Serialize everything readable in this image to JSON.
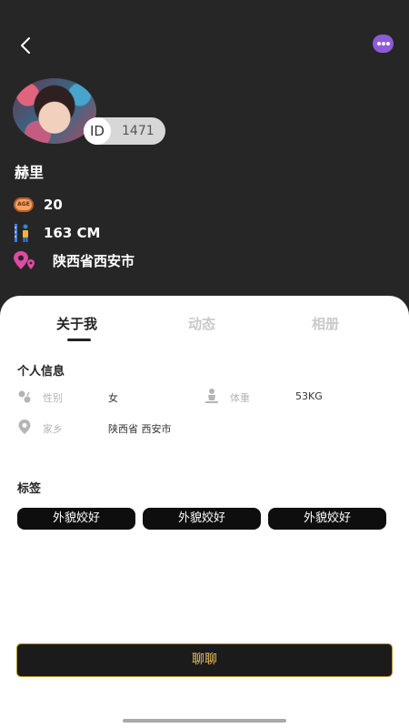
{
  "profile": {
    "id_label": "ID",
    "id_value": "1471",
    "name": "赫里",
    "age_badge": "AGE",
    "age": "20",
    "height": "163 CM",
    "location": "陕西省西安市"
  },
  "tabs": [
    {
      "label": "关于我",
      "active": true
    },
    {
      "label": "动态",
      "active": false
    },
    {
      "label": "相册",
      "active": false
    }
  ],
  "personal_info": {
    "title": "个人信息",
    "gender_label": "性别",
    "gender_value": "女",
    "weight_label": "体重",
    "weight_value": "53KG",
    "hometown_label": "家乡",
    "hometown_value": "陕西省 西安市"
  },
  "tags_section": {
    "title": "标签",
    "tags": [
      "外貌姣好",
      "外貌姣好",
      "外貌姣好"
    ]
  },
  "chat_button": {
    "label": "聊聊"
  },
  "colors": {
    "accent_purple": "#8e5bd8",
    "gold": "#e8c25c",
    "dark_bg": "#262626"
  }
}
